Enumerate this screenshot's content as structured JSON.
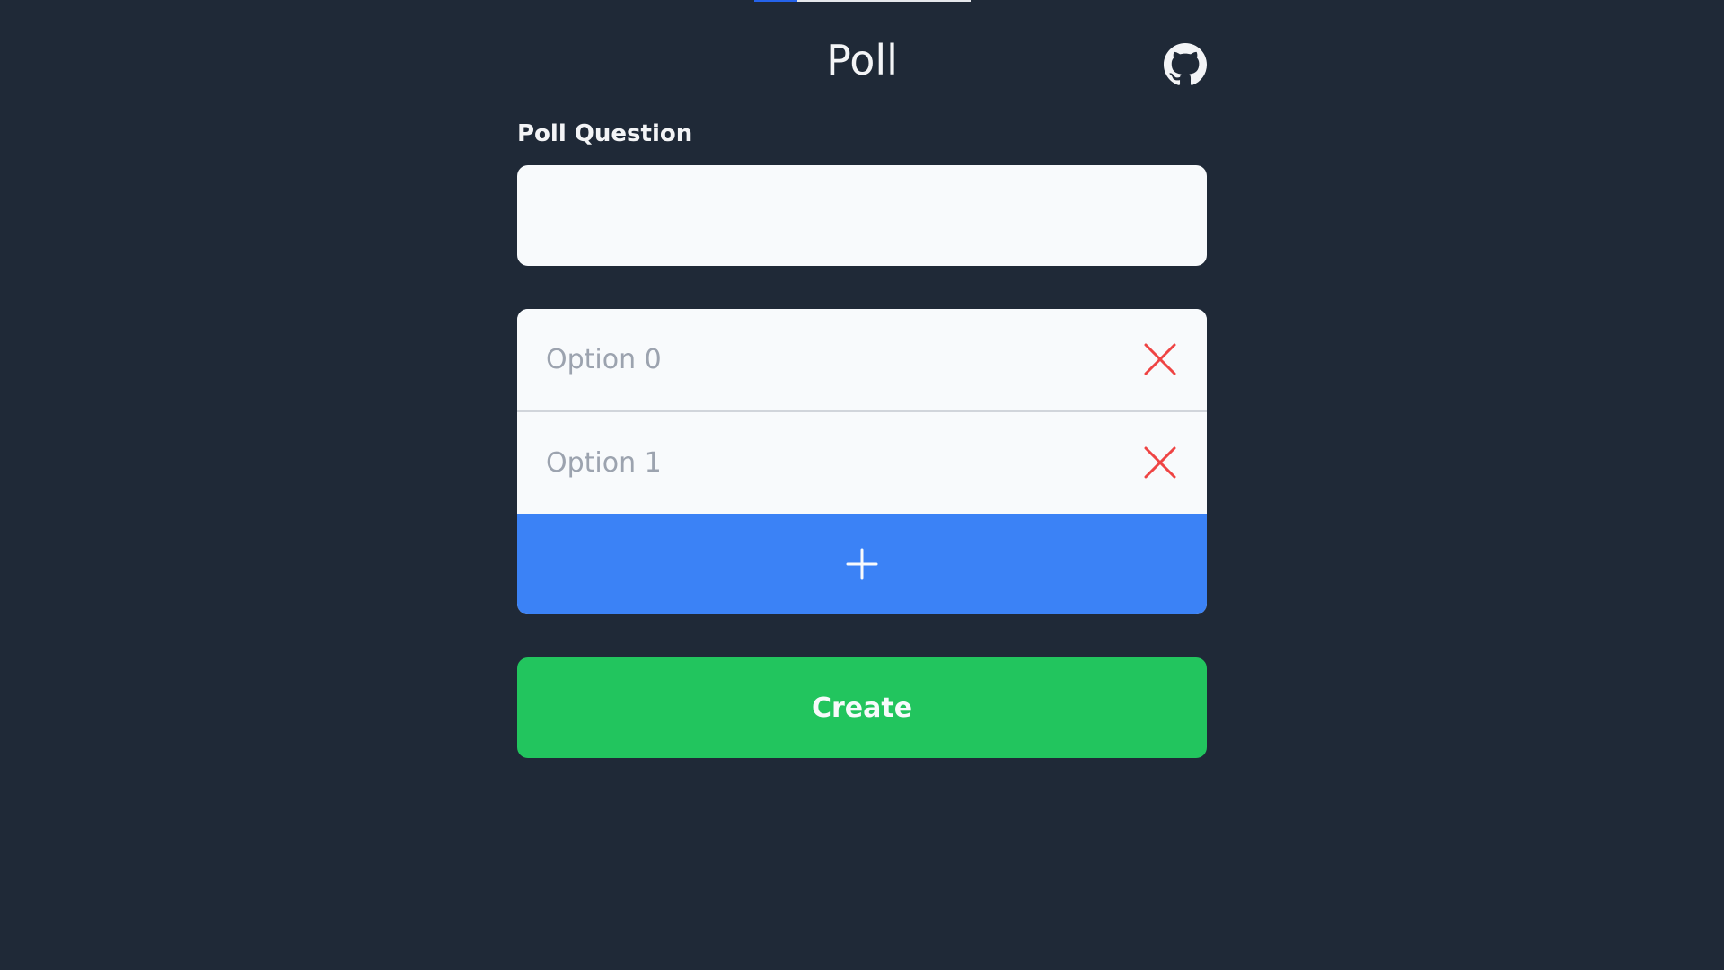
{
  "header": {
    "title": "Poll",
    "github_icon": "github-icon"
  },
  "page_progress": 0.2,
  "question": {
    "label": "Poll Question",
    "value": "",
    "placeholder": ""
  },
  "options": [
    {
      "placeholder": "Option 0",
      "value": "",
      "remove_icon": "close-icon"
    },
    {
      "placeholder": "Option 1",
      "value": "",
      "remove_icon": "close-icon"
    }
  ],
  "add_option": {
    "icon": "plus-icon"
  },
  "create_button": {
    "label": "Create"
  },
  "colors": {
    "background": "#1f2937",
    "input_background": "#f8fafc",
    "accent_blue": "#3b82f6",
    "accent_green": "#22c55e",
    "danger_red": "#ef4444"
  }
}
